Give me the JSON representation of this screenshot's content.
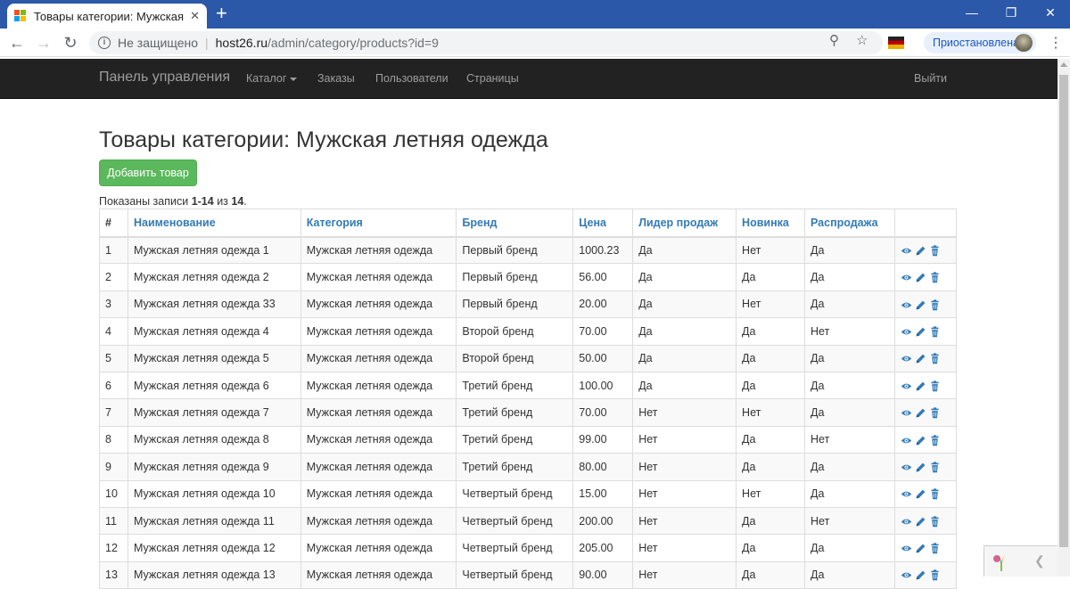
{
  "browser": {
    "tab_title": "Товары категории: Мужская лет",
    "tab_close": "✕",
    "new_tab": "+",
    "security_text": "Не защищено",
    "url_host": "host26.ru",
    "url_path": "/admin/category/products?id=9",
    "profile_label": "Приостановлена"
  },
  "navbar": {
    "brand": "Панель управления",
    "items": [
      {
        "label": "Каталог",
        "dropdown": true
      },
      {
        "label": "Заказы"
      },
      {
        "label": "Пользователи"
      },
      {
        "label": "Страницы"
      }
    ],
    "logout": "Выйти"
  },
  "page": {
    "title": "Товары категории: Мужская летняя одежда",
    "add_button": "Добавить товар",
    "summary_prefix": "Показаны записи ",
    "summary_range": "1-14",
    "summary_mid": " из ",
    "summary_total": "14",
    "summary_suffix": "."
  },
  "table": {
    "headers": [
      "#",
      "Наименование",
      "Категория",
      "Бренд",
      "Цена",
      "Лидер продаж",
      "Новинка",
      "Распродажа",
      ""
    ],
    "rows": [
      [
        "1",
        "Мужская летняя одежда 1",
        "Мужская летняя одежда",
        "Первый бренд",
        "1000.23",
        "Да",
        "Нет",
        "Да"
      ],
      [
        "2",
        "Мужская летняя одежда 2",
        "Мужская летняя одежда",
        "Первый бренд",
        "56.00",
        "Да",
        "Да",
        "Да"
      ],
      [
        "3",
        "Мужская летняя одежда 33",
        "Мужская летняя одежда",
        "Первый бренд",
        "20.00",
        "Да",
        "Нет",
        "Да"
      ],
      [
        "4",
        "Мужская летняя одежда 4",
        "Мужская летняя одежда",
        "Второй бренд",
        "70.00",
        "Да",
        "Да",
        "Нет"
      ],
      [
        "5",
        "Мужская летняя одежда 5",
        "Мужская летняя одежда",
        "Второй бренд",
        "50.00",
        "Да",
        "Да",
        "Да"
      ],
      [
        "6",
        "Мужская летняя одежда 6",
        "Мужская летняя одежда",
        "Третий бренд",
        "100.00",
        "Да",
        "Да",
        "Да"
      ],
      [
        "7",
        "Мужская летняя одежда 7",
        "Мужская летняя одежда",
        "Третий бренд",
        "70.00",
        "Нет",
        "Нет",
        "Да"
      ],
      [
        "8",
        "Мужская летняя одежда 8",
        "Мужская летняя одежда",
        "Третий бренд",
        "99.00",
        "Нет",
        "Да",
        "Нет"
      ],
      [
        "9",
        "Мужская летняя одежда 9",
        "Мужская летняя одежда",
        "Третий бренд",
        "80.00",
        "Нет",
        "Да",
        "Да"
      ],
      [
        "10",
        "Мужская летняя одежда 10",
        "Мужская летняя одежда",
        "Четвертый бренд",
        "15.00",
        "Нет",
        "Нет",
        "Да"
      ],
      [
        "11",
        "Мужская летняя одежда 11",
        "Мужская летняя одежда",
        "Четвертый бренд",
        "200.00",
        "Нет",
        "Да",
        "Нет"
      ],
      [
        "12",
        "Мужская летняя одежда 12",
        "Мужская летняя одежда",
        "Четвертый бренд",
        "205.00",
        "Нет",
        "Да",
        "Да"
      ],
      [
        "13",
        "Мужская летняя одежда 13",
        "Мужская летняя одежда",
        "Четвертый бренд",
        "90.00",
        "Нет",
        "Да",
        "Да"
      ]
    ],
    "row_actions": [
      "eye-icon",
      "pencil-icon",
      "trash-icon"
    ]
  },
  "colors": {
    "link": "#337ab7",
    "success": "#5cb85c",
    "navbar": "#222222",
    "tabstrip": "#2b58a8"
  }
}
